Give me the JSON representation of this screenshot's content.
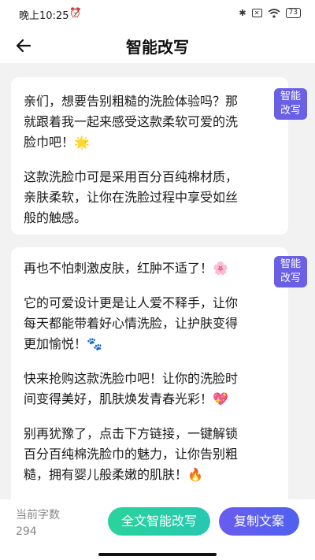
{
  "status_bar": {
    "time": "晚上10:25",
    "mute_icon": "alarm-off-icon",
    "battery": "73"
  },
  "header": {
    "title": "智能改写",
    "back_icon": "arrow-left-icon"
  },
  "cards": [
    {
      "paragraphs": [
        "亲们，想要告别粗糙的洗脸体验吗？那",
        "就跟着我一起来感受这款柔软可爱的洗",
        "脸巾吧！🌟",
        "这款洗脸巾可是采用百分百纯棉材质，",
        "亲肤柔软，让你在洗脸过程中享受如丝",
        "般的触感。"
      ],
      "rewrite_label_line1": "智能",
      "rewrite_label_line2": "改写"
    },
    {
      "paragraphs": [
        "再也不怕刺激皮肤，红肿不适了！🌸",
        "它的可爱设计更是让人爱不释手，让你",
        "每天都能带着好心情洗脸，让护肤变得",
        "更加愉悦！🐾",
        "快来抢购这款洗脸巾吧！让你的洗脸时",
        "间变得美好，肌肤焕发青春光彩！💖",
        "别再犹豫了，点击下方链接，一键解锁",
        "百分百纯棉洗脸巾的魅力，让你告别粗",
        "糙，拥有婴儿般柔嫩的肌肤！🔥"
      ],
      "rewrite_label_line1": "智能",
      "rewrite_label_line2": "改写"
    }
  ],
  "footer": {
    "count_label": "当前字数",
    "count_value": "294",
    "rewrite_all_label": "全文智能改写",
    "copy_label": "复制文案"
  },
  "colors": {
    "accent_purple": "#6a60e6",
    "accent_green": "#2ad39c",
    "background": "#f2f2f2"
  }
}
